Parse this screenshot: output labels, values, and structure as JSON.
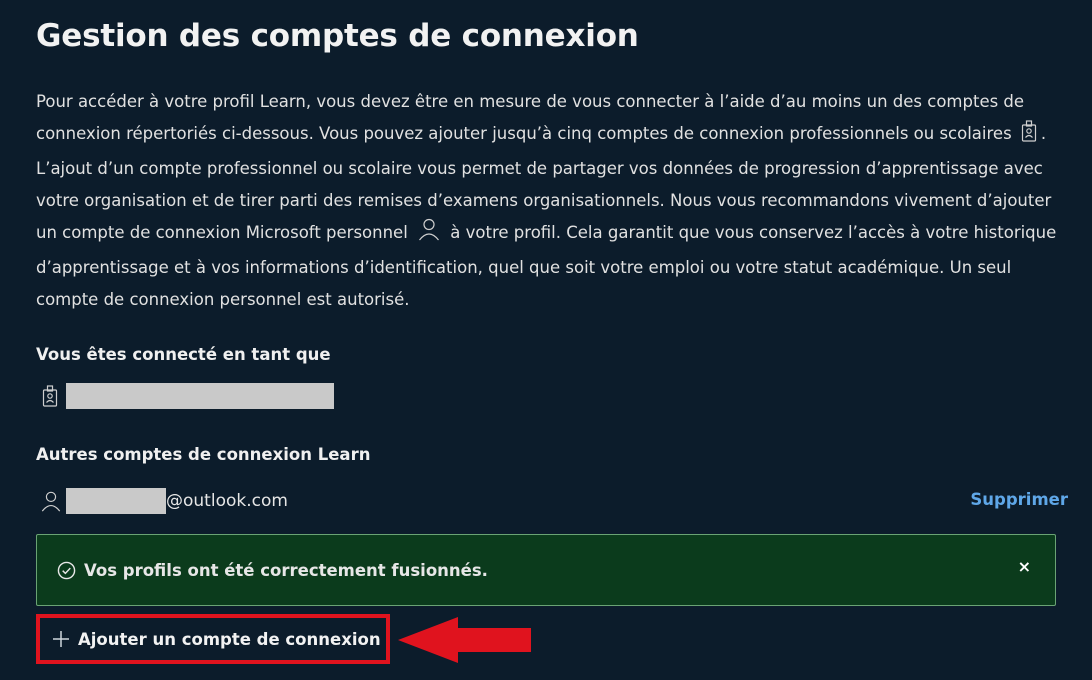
{
  "page": {
    "title": "Gestion des comptes de connexion",
    "intro": {
      "part1": "Pour accéder à votre profil Learn, vous devez être en mesure de vous connecter à l’aide d’au moins un des comptes de connexion répertoriés ci-dessous. Vous pouvez ajouter jusqu’à cinq comptes de connexion professionnels ou scolaires",
      "part2": ". L’ajout d’un compte professionnel ou scolaire vous permet de partager vos données de progression d’apprentissage avec votre organisation et de tirer parti des remises d’examens organisationnels. Nous vous recommandons vivement d’ajouter un compte de connexion Microsoft personnel",
      "part3": "à votre profil. Cela garantit que vous conservez l’accès à votre historique d’apprentissage et à vos informations d’identification, quel que soit votre emploi ou votre statut académique. Un seul compte de connexion personnel est autorisé."
    }
  },
  "signed_in": {
    "label": "Vous êtes connecté en tant que"
  },
  "other_accounts": {
    "label": "Autres comptes de connexion Learn",
    "items": [
      {
        "email_suffix": "@outlook.com",
        "remove_label": "Supprimer"
      }
    ]
  },
  "alert": {
    "message": "Vos profils ont été correctement fusionnés.",
    "close_label": "×"
  },
  "add_account": {
    "label": "Ajouter un compte de connexion"
  },
  "colors": {
    "background": "#0c1c2b",
    "link": "#5fa7e8",
    "success_bg": "#0b3b1c",
    "success_border": "#6aa374",
    "highlight": "#e0131e"
  }
}
